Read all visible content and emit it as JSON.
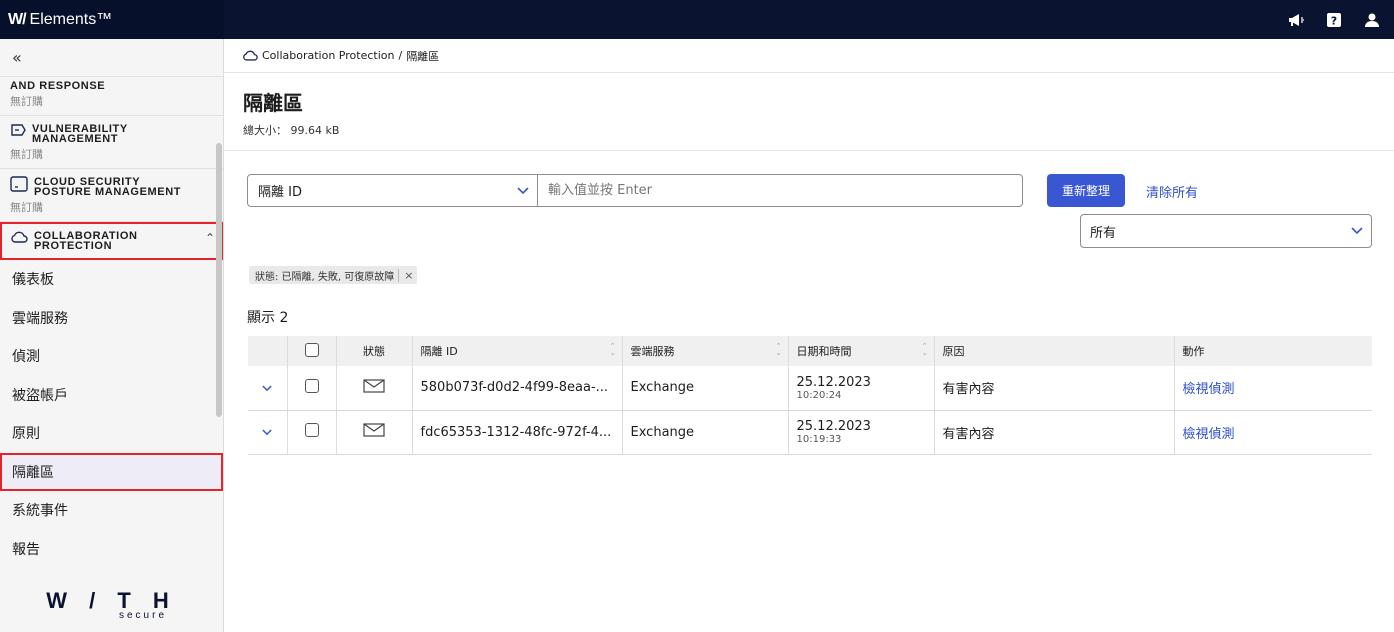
{
  "app": {
    "brand_mark": "W/",
    "brand_name": "Elements™"
  },
  "topbar": {
    "icons": [
      "megaphone-icon",
      "help-icon",
      "user-icon"
    ]
  },
  "sidebar": {
    "collapse_label": "«",
    "sections": [
      {
        "title": "AND RESPONSE",
        "subtitle": "無訂購"
      },
      {
        "title": "VULNERABILITY MANAGEMENT",
        "subtitle": "無訂購"
      },
      {
        "title": "CLOUD SECURITY POSTURE MANAGEMENT",
        "subtitle": "無訂購"
      },
      {
        "title": "COLLABORATION PROTECTION",
        "subtitle": ""
      }
    ],
    "items": [
      {
        "label": "儀表板"
      },
      {
        "label": "雲端服務"
      },
      {
        "label": "偵測"
      },
      {
        "label": "被盜帳戶"
      },
      {
        "label": "原則"
      },
      {
        "label": "隔離區"
      },
      {
        "label": "系統事件"
      },
      {
        "label": "報告"
      }
    ],
    "footer_logo": "W / T H",
    "footer_sub": "secure"
  },
  "breadcrumb": {
    "root": "Collaboration Protection",
    "separator": "/",
    "current": "隔離區"
  },
  "page": {
    "title": "隔離區",
    "size_label": "總大小： 99.64 kB"
  },
  "filters": {
    "field_value": "隔離 ID",
    "search_placeholder": "輸入值並按 Enter",
    "refresh_label": "重新整理",
    "clear_label": "清除所有",
    "status_value": "所有",
    "chip_label": "狀態: 已隔離, 失敗, 可復原故障",
    "chip_close": "×"
  },
  "results": {
    "count_label": "顯示 2"
  },
  "table": {
    "headers": {
      "status": "狀態",
      "id": "隔離 ID",
      "service": "雲端服務",
      "datetime": "日期和時間",
      "reason": "原因",
      "action": "動作"
    },
    "rows": [
      {
        "id": "580b073f-d0d2-4f99-8eaa-...",
        "service": "Exchange",
        "date": "25.12.2023",
        "time": "10:20:24",
        "reason": "有害內容",
        "action": "檢視偵測"
      },
      {
        "id": "fdc65353-1312-48fc-972f-4...",
        "service": "Exchange",
        "date": "25.12.2023",
        "time": "10:19:33",
        "reason": "有害內容",
        "action": "檢視偵測"
      }
    ]
  },
  "colors": {
    "topbar": "#0a1330",
    "accent": "#3a57d3",
    "highlight": "#e3242b"
  }
}
